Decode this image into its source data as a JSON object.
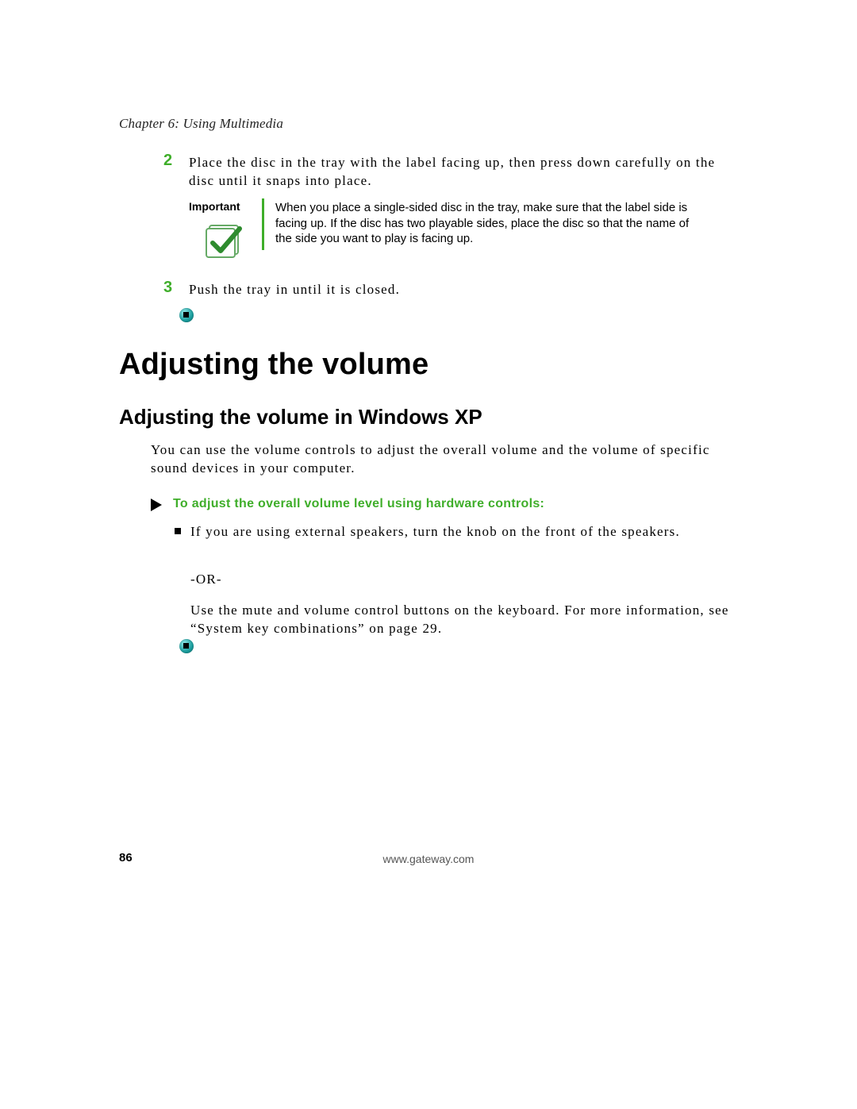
{
  "chapter_header": "Chapter 6: Using Multimedia",
  "steps": {
    "s2_num": "2",
    "s2_text": "Place the disc in the tray with the label facing up, then press down carefully on the disc until it snaps into place.",
    "s3_num": "3",
    "s3_text": "Push the tray in until it is closed."
  },
  "important": {
    "label": "Important",
    "text": "When you place a single-sided disc in the tray, make sure that the label side is facing up. If the disc has two playable sides, place the disc so that the name of the side you want to play is facing up."
  },
  "h1": "Adjusting the volume",
  "h2": "Adjusting the volume in Windows XP",
  "intro_para": "You can use the volume controls to adjust the overall volume and the volume of specific sound devices in your computer.",
  "procedure_title": "To adjust the overall volume level using hardware controls:",
  "bullet1": "If you are using external speakers, turn the knob on the front of the speakers.",
  "or_text": "-OR-",
  "bullet2": "Use the mute and volume control buttons on the keyboard. For more information, see “System key combinations” on page 29.",
  "footer": {
    "page_num": "86",
    "url": "www.gateway.com"
  }
}
